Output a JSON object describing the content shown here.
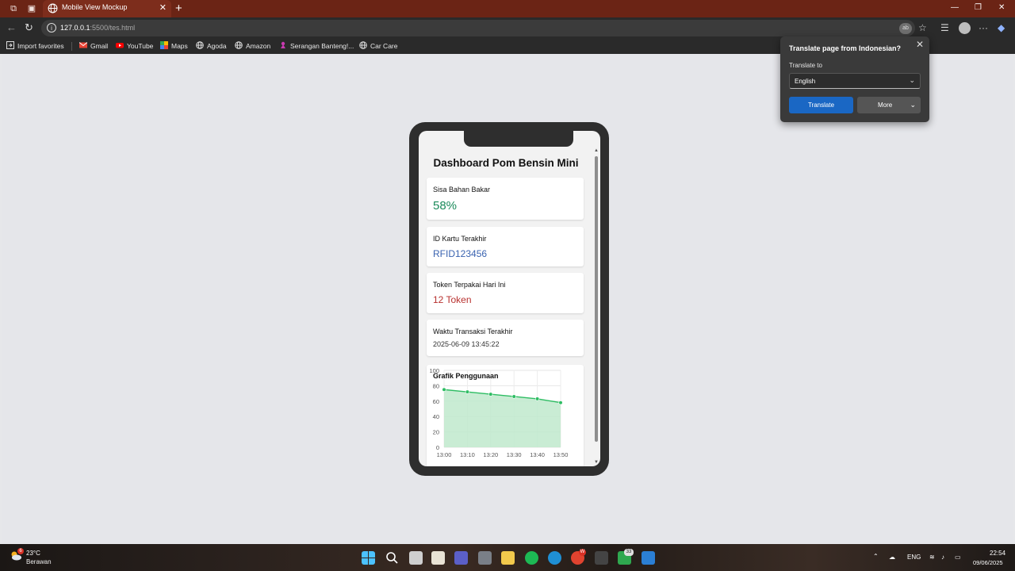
{
  "browser": {
    "tab_title": "Mobile View Mockup",
    "url_host": "127.0.0.1",
    "url_rest": ":5500/tes.html",
    "translate_pill": "ab"
  },
  "bookmarks": {
    "import_favorites": "Import favorites",
    "items": [
      "Gmail",
      "YouTube",
      "Maps",
      "Agoda",
      "Amazon",
      "Serangan Banteng!...",
      "Car Care"
    ]
  },
  "translate_popup": {
    "title": "Translate page from Indonesian?",
    "label": "Translate to",
    "selected_language": "English",
    "translate_button": "Translate",
    "more_button": "More"
  },
  "dashboard": {
    "title": "Dashboard Pom Bensin Mini",
    "cards": [
      {
        "label": "Sisa Bahan Bakar",
        "value": "58%",
        "color": "#1a8a5a"
      },
      {
        "label": "ID Kartu Terakhir",
        "value": "RFID123456",
        "color": "#3a63b0"
      },
      {
        "label": "Token Terpakai Hari Ini",
        "value": "12 Token",
        "color": "#b8312f"
      },
      {
        "label": "Waktu Transaksi Terakhir",
        "value": "2025-06-09 13:45:22",
        "color": "#333333"
      }
    ]
  },
  "chart_data": {
    "type": "area",
    "title": "Grafik Penggunaan",
    "categories": [
      "13:00",
      "13:10",
      "13:20",
      "13:30",
      "13:40",
      "13:50"
    ],
    "values": [
      75,
      72,
      69,
      66,
      63,
      58
    ],
    "ylim": [
      0,
      100
    ],
    "yticks": [
      "0",
      "20",
      "40",
      "60",
      "80",
      "100"
    ],
    "line_color": "#2ebd63",
    "fill_color": "#bfe9cd",
    "grid": true
  },
  "taskbar": {
    "temperature": "23°C",
    "weather": "Berawan",
    "language": "ENG",
    "time": "22:54",
    "date": "09/06/2025",
    "weather_badge": "6",
    "chrome_badge": "W",
    "whatsapp_badge": "33"
  }
}
